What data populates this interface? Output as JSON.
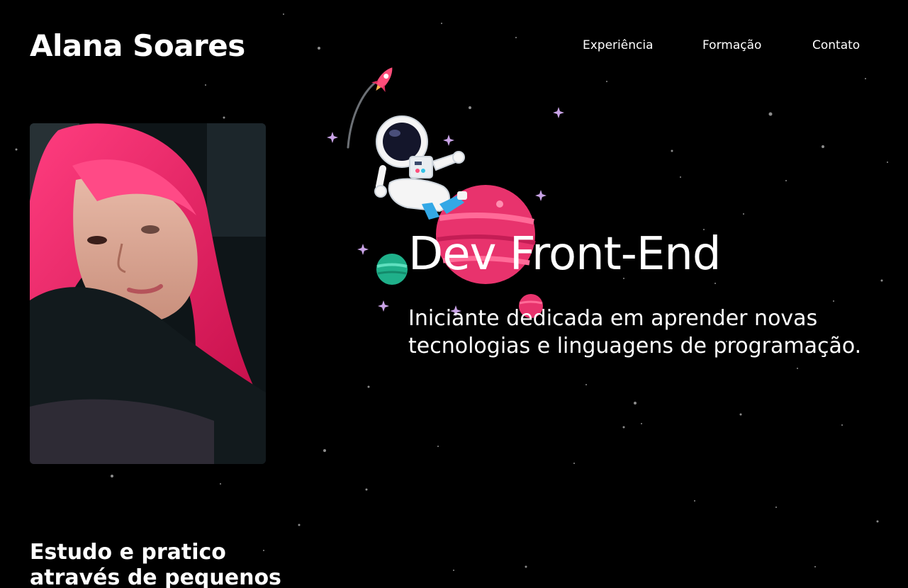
{
  "header": {
    "name": "Alana Soares",
    "nav": [
      "Experiência",
      "Formação",
      "Contato"
    ]
  },
  "hero": {
    "title": "Dev Front-End",
    "subtitle": "Iniciante dedicada em aprender novas tecnologias e linguagens de programação."
  },
  "intro": {
    "text": "Estudo e pratico através de pequenos"
  },
  "colors": {
    "background": "#000000",
    "text": "#ffffff",
    "planet_pink": "#e8336d",
    "planet_teal": "#1fb08a",
    "sparkle": "#c9a3e6"
  },
  "icons": [
    "rocket-icon",
    "astronaut-icon",
    "planet-icon",
    "sparkle-icon"
  ]
}
